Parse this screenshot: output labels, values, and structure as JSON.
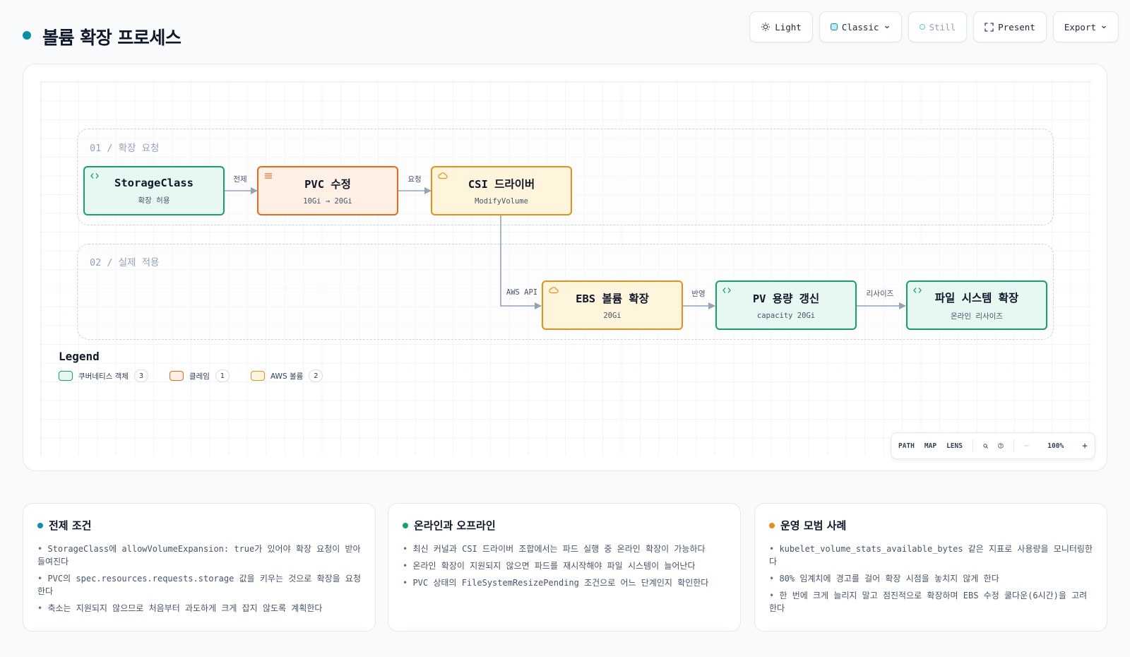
{
  "header": {
    "title": "볼륨 확장 프로세스",
    "toolbar": {
      "theme_label": "Light",
      "style_label": "Classic",
      "motion_label": "Still",
      "present_label": "Present",
      "export_label": "Export"
    }
  },
  "diagram": {
    "groups": [
      {
        "label": "01 / 확장 요청"
      },
      {
        "label": "02 / 실제 적용"
      }
    ],
    "nodes": {
      "storageclass": {
        "title": "StorageClass",
        "subtitle": "확장 허용",
        "kind": "k8s",
        "icon": "code-brackets-icon"
      },
      "pvc": {
        "title": "PVC 수정",
        "subtitle": "10Gi → 20Gi",
        "kind": "claim",
        "icon": "list-lines-icon"
      },
      "csi": {
        "title": "CSI 드라이버",
        "subtitle": "ModifyVolume",
        "kind": "aws",
        "icon": "cloud-icon"
      },
      "ebs": {
        "title": "EBS 볼륨 확장",
        "subtitle": "20Gi",
        "kind": "aws",
        "icon": "cloud-icon"
      },
      "pv": {
        "title": "PV 용량 갱신",
        "subtitle": "capacity 20Gi",
        "kind": "k8s",
        "icon": "code-brackets-icon"
      },
      "fs": {
        "title": "파일 시스템 확장",
        "subtitle": "온라인 리사이즈",
        "kind": "k8s",
        "icon": "code-brackets-icon"
      }
    },
    "edges": [
      {
        "from": "storageclass",
        "to": "pvc",
        "label": "전제"
      },
      {
        "from": "pvc",
        "to": "csi",
        "label": "요청"
      },
      {
        "from": "csi",
        "to": "ebs",
        "label": "AWS API"
      },
      {
        "from": "ebs",
        "to": "pv",
        "label": "반영"
      },
      {
        "from": "pv",
        "to": "fs",
        "label": "리사이즈"
      }
    ],
    "colors": {
      "k8s_border": "#16a06a",
      "k8s_fill": "#e6f8f1",
      "claim_border": "#ea6a1c",
      "claim_fill": "#fff0e6",
      "aws_border": "#e6901a",
      "aws_fill": "#fff5dc",
      "edge": "#94a3b8"
    }
  },
  "legend": {
    "title": "Legend",
    "items": [
      {
        "label": "쿠버네티스 객체",
        "count": "3"
      },
      {
        "label": "클레임",
        "count": "1"
      },
      {
        "label": "AWS 볼륨",
        "count": "2"
      }
    ]
  },
  "controls": {
    "path": "PATH",
    "map": "MAP",
    "lens": "LENS",
    "zoom": "100%",
    "minus": "−",
    "plus": "+"
  },
  "cards": [
    {
      "title": "전제 조건",
      "dot_color": "#0e8fa8",
      "items": [
        "StorageClass에 allowVolumeExpansion: true가 있어야 확장 요청이 받아들여진다",
        "PVC의 spec.resources.requests.storage 값을 키우는 것으로 확장을 요청한다",
        "축소는 지원되지 않으므로 처음부터 과도하게 크게 잡지 않도록 계획한다"
      ]
    },
    {
      "title": "온라인과 오프라인",
      "dot_color": "#16a06a",
      "items": [
        "최신 커널과 CSI 드라이버 조합에서는 파드 실행 중 온라인 확장이 가능하다",
        "온라인 확장이 지원되지 않으면 파드를 재시작해야 파일 시스템이 늘어난다",
        "PVC 상태의 FileSystemResizePending 조건으로 어느 단계인지 확인한다"
      ]
    },
    {
      "title": "운영 모범 사례",
      "dot_color": "#e6901a",
      "items": [
        "kubelet_volume_stats_available_bytes 같은 지표로 사용량을 모니터링한다",
        "80% 임계치에 경고를 걸어 확장 시점을 놓치지 않게 한다",
        "한 번에 크게 늘리지 말고 점진적으로 확장하며 EBS 수정 쿨다운(6시간)을 고려한다"
      ]
    }
  ]
}
